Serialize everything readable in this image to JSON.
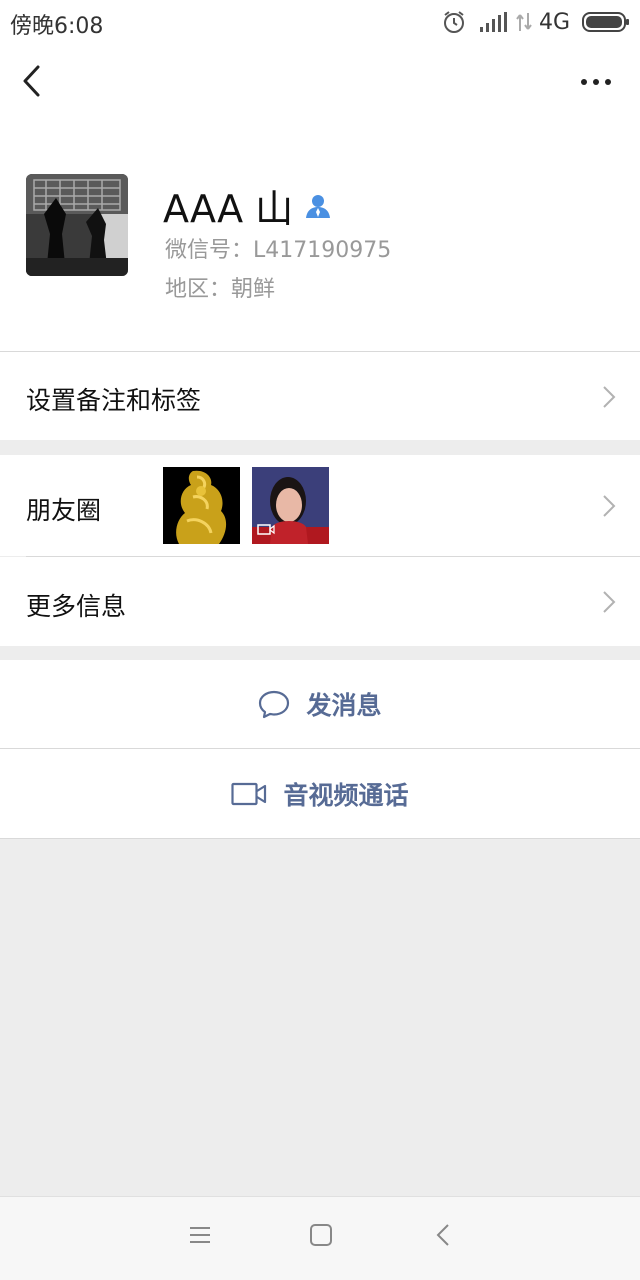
{
  "status_bar": {
    "time": "傍晚6:08",
    "network": "4G"
  },
  "header": {
    "back_icon": "back-icon",
    "more_icon": "more-icon"
  },
  "profile": {
    "name": "AAA 山",
    "wechat_id": "微信号：L417190975",
    "region": "地区：朝鲜"
  },
  "rows": {
    "remark_tags": "设置备注和标签",
    "moments": "朋友圈",
    "more_info": "更多信息"
  },
  "actions": {
    "send_message": "发消息",
    "video_call": "音视频通话"
  },
  "colors": {
    "accent": "#576b95",
    "background": "#ededed",
    "verified_icon": "#4a90e2"
  }
}
